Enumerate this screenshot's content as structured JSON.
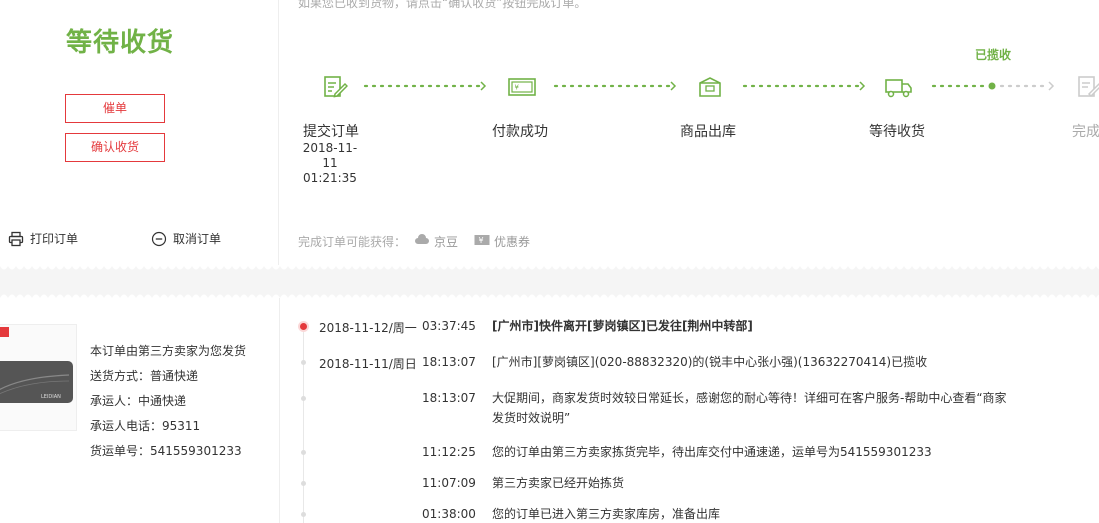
{
  "order_status": {
    "title": "等待收货",
    "urge_button": "催单",
    "confirm_button": "确认收货",
    "print_label": "打印订单",
    "cancel_label": "取消订单"
  },
  "progress": {
    "tip": "如果您已收到货物，请点击“确认收货”按钮完成订单。",
    "collected_badge": "已揽收",
    "steps": [
      {
        "label": "提交订单",
        "date": "2018-11-11",
        "time": "01:21:35",
        "icon": "edit-document-icon"
      },
      {
        "label": "付款成功",
        "icon": "credit-card-icon"
      },
      {
        "label": "商品出库",
        "icon": "package-box-icon"
      },
      {
        "label": "等待收货",
        "icon": "delivery-truck-icon"
      },
      {
        "label": "完成",
        "icon": "done-document-icon"
      }
    ],
    "benefit_prefix": "完成订单可能获得：",
    "benefit_jingdou": "京豆",
    "benefit_coupon": "优惠券"
  },
  "shipping": {
    "line1": "本订单由第三方卖家为您发货",
    "line2": "送货方式：普通快递",
    "line3": "承运人：中通快递",
    "line4": "承运人电话：95311",
    "line5": "货运单号：541559301233",
    "product_brand": "LEIDIAN"
  },
  "tracking": [
    {
      "date": "2018-11-12/周一",
      "time": "03:37:45",
      "msg": "[广州市]快件离开[萝岗镇区]已发往[荆州中转部]"
    },
    {
      "date": "2018-11-11/周日",
      "time": "18:13:07",
      "msg": "[广州市][萝岗镇区](020-88832320)的(锐丰中心张小强)(13632270414)已揽收"
    },
    {
      "date": "",
      "time": "18:13:07",
      "msg": "大促期间，商家发货时效较日常延长，感谢您的耐心等待！详细可在客户服务-帮助中心查看“商家发货时效说明”"
    },
    {
      "date": "",
      "time": "11:12:25",
      "msg": "您的订单由第三方卖家拣货完毕，待出库交付中通速递，运单号为541559301233"
    },
    {
      "date": "",
      "time": "11:07:09",
      "msg": "第三方卖家已经开始拣货"
    },
    {
      "date": "",
      "time": "01:38:00",
      "msg": "您的订单已进入第三方卖家库房，准备出库"
    }
  ],
  "colors": {
    "accent_green": "#71b247",
    "accent_red": "#e4393c",
    "muted": "#aaaaaa"
  }
}
